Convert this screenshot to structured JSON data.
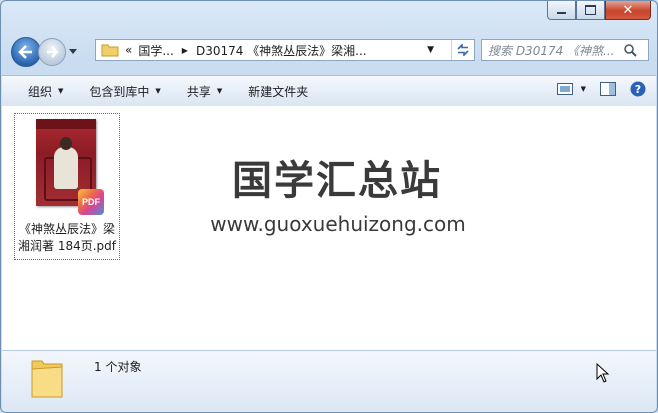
{
  "address": {
    "overflow": "«",
    "crumb_root": "国学...",
    "crumb_current": "D30174 《神煞丛辰法》梁湘..."
  },
  "search": {
    "placeholder": "搜索 D30174 《神煞..."
  },
  "toolbar": {
    "organize": "组织",
    "include_library": "包含到库中",
    "share": "共享",
    "new_folder": "新建文件夹"
  },
  "file": {
    "name_line1": "《神煞丛辰法》梁",
    "name_line2": "湘润著 184页.pdf",
    "badge": "PDF"
  },
  "watermark": {
    "title": "国学汇总站",
    "url": "www.guoxuehuizong.com"
  },
  "details": {
    "count": "1 个对象"
  },
  "colors": {
    "accent": "#2a66b2",
    "close": "#c7442b"
  }
}
